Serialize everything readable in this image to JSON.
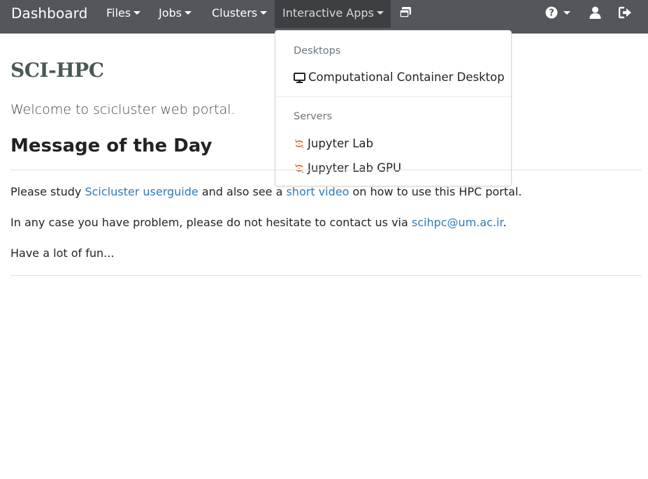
{
  "navbar": {
    "brand": "Dashboard",
    "items": [
      {
        "label": "Files"
      },
      {
        "label": "Jobs"
      },
      {
        "label": "Clusters"
      },
      {
        "label": "Interactive Apps"
      }
    ],
    "icons": [
      "windows-icon",
      "help-icon",
      "user-icon",
      "logout-icon"
    ]
  },
  "dropdown": {
    "desktops_header": "Desktops",
    "desktop_items": [
      {
        "label": "Computational Container Desktop",
        "icon": "monitor-icon"
      }
    ],
    "servers_header": "Servers",
    "server_items": [
      {
        "label": "Jupyter Lab",
        "icon": "jupyter-icon"
      },
      {
        "label": "Jupyter Lab GPU",
        "icon": "jupyter-icon"
      }
    ]
  },
  "main": {
    "site_title": "SCI-HPC",
    "welcome": "Welcome to scicluster web portal.",
    "motd_title": "Message of the Day",
    "p1": {
      "text1": "Please study ",
      "link1": "Scicluster userguide",
      "text2": " and also see a ",
      "link2": "short video",
      "text3": " on how to use this HPC portal."
    },
    "p2": {
      "text1": "In any case you have problem, please do not hesitate to contact us via ",
      "link1": "scihpc@um.ac.ir",
      "text2": "."
    },
    "p3": "Have a lot of fun..."
  },
  "colors": {
    "navbar": "#53565a",
    "navbar_active": "#3d4043",
    "link": "#2f7ab7",
    "title": "#4a5a52",
    "jupyter_orange": "#e46e2e"
  }
}
